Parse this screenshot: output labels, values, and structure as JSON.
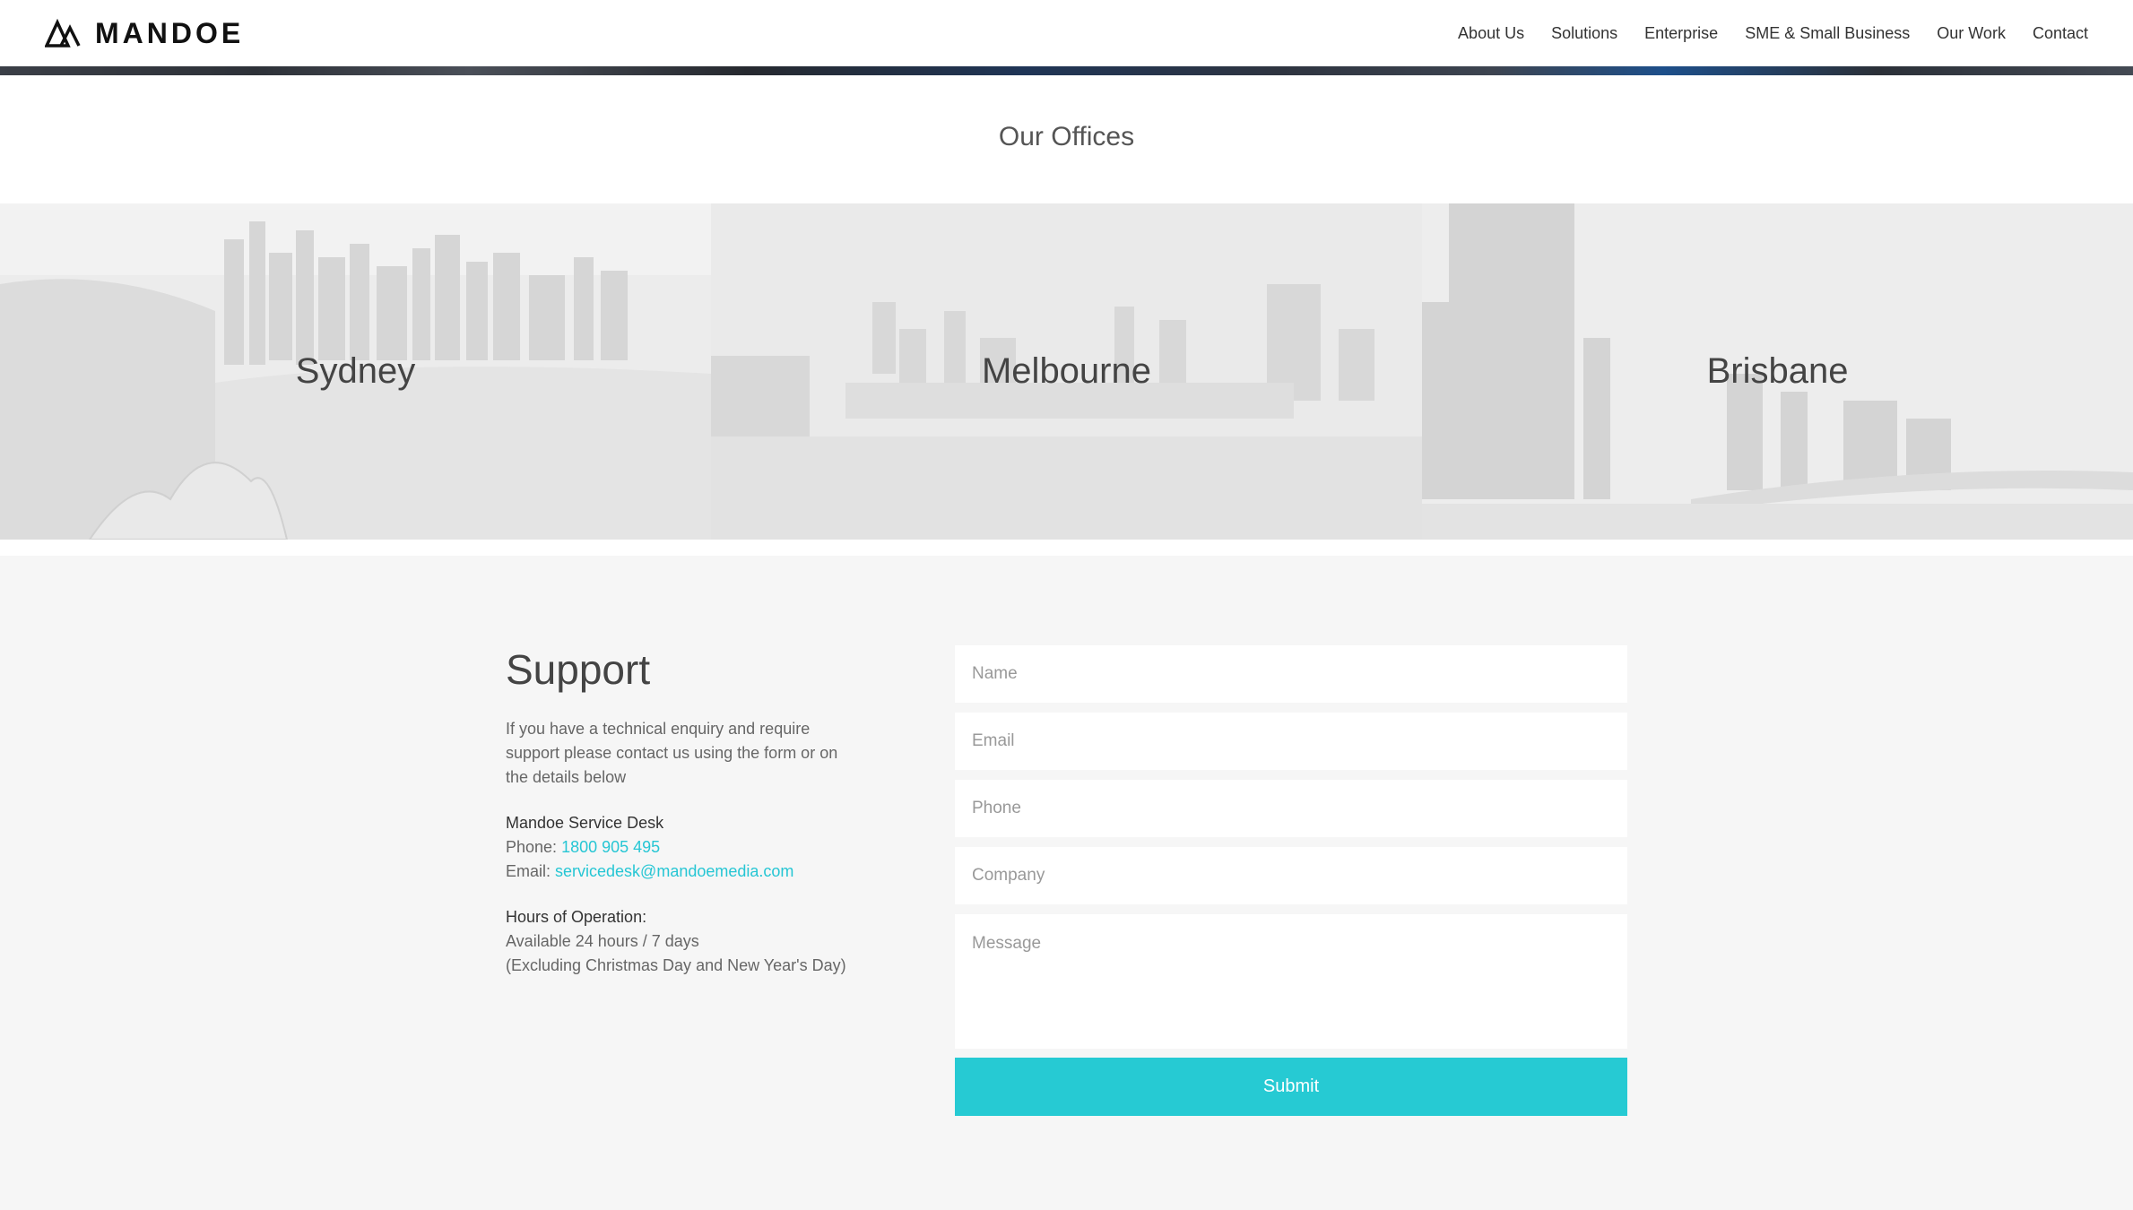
{
  "header": {
    "logo_text": "MANDOE",
    "nav": [
      {
        "label": "About Us"
      },
      {
        "label": "Solutions"
      },
      {
        "label": "Enterprise"
      },
      {
        "label": "SME & Small Business"
      },
      {
        "label": "Our Work"
      },
      {
        "label": "Contact"
      }
    ]
  },
  "offices": {
    "title": "Our Offices",
    "cities": [
      {
        "label": "Sydney"
      },
      {
        "label": "Melbourne"
      },
      {
        "label": "Brisbane"
      }
    ]
  },
  "support": {
    "title": "Support",
    "description": "If you have a technical enquiry and require support please contact us using the form or on the details below",
    "service_desk_heading": "Mandoe Service Desk",
    "phone_label": "Phone: ",
    "phone_value": "1800 905 495",
    "email_label": "Email: ",
    "email_value": "servicedesk@mandoemedia.com",
    "hours_heading": "Hours of Operation:",
    "hours_line1": "Available 24 hours / 7 days",
    "hours_line2": "(Excluding Christmas Day and New Year's Day)"
  },
  "form": {
    "name_placeholder": "Name",
    "email_placeholder": "Email",
    "phone_placeholder": "Phone",
    "company_placeholder": "Company",
    "message_placeholder": "Message",
    "submit_label": "Submit"
  },
  "colors": {
    "accent": "#26cad3",
    "link": "#26c6d4"
  }
}
